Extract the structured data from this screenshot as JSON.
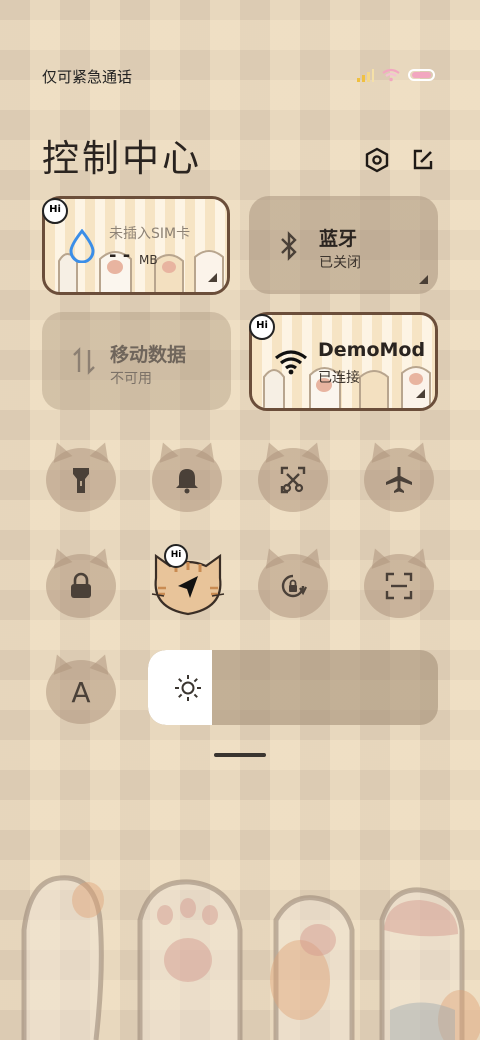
{
  "status_bar": {
    "carrier_text": "仅可紧急通话",
    "signal_color": "#f0c040",
    "wifi_color": "#f2a7c0",
    "battery_color": "#ffffff"
  },
  "header": {
    "title": "控制中心",
    "settings_icon": "hexagon-settings-icon",
    "edit_icon": "edit-icon"
  },
  "tiles": {
    "data_usage": {
      "line1": "未插入SIM卡",
      "value": "- -",
      "unit": "MB"
    },
    "bluetooth": {
      "title": "蓝牙",
      "status": "已关闭"
    },
    "mobile_data": {
      "title": "移动数据",
      "status": "不可用"
    },
    "wifi": {
      "title": "DemoMod",
      "status": "已连接"
    }
  },
  "badges": {
    "hi": "Hi"
  },
  "toggles": [
    {
      "name": "flashlight",
      "icon": "flashlight-icon",
      "active": false
    },
    {
      "name": "silent",
      "icon": "bell-icon",
      "active": false
    },
    {
      "name": "screenshot",
      "icon": "screenshot-icon",
      "active": false
    },
    {
      "name": "airplane",
      "icon": "airplane-icon",
      "active": false
    },
    {
      "name": "lock",
      "icon": "lock-icon",
      "active": false
    },
    {
      "name": "location",
      "icon": "location-icon",
      "active": true
    },
    {
      "name": "auto-rotate",
      "icon": "rotate-lock-icon",
      "active": false
    },
    {
      "name": "scan",
      "icon": "scan-icon",
      "active": false
    }
  ],
  "font_button": {
    "label": "A"
  },
  "brightness": {
    "level": 0.22,
    "icon": "sun-icon"
  },
  "colors": {
    "accent_dark": "#2a2420",
    "tile_border": "#6b4e3a",
    "water_drop": "#3b8ee8"
  }
}
